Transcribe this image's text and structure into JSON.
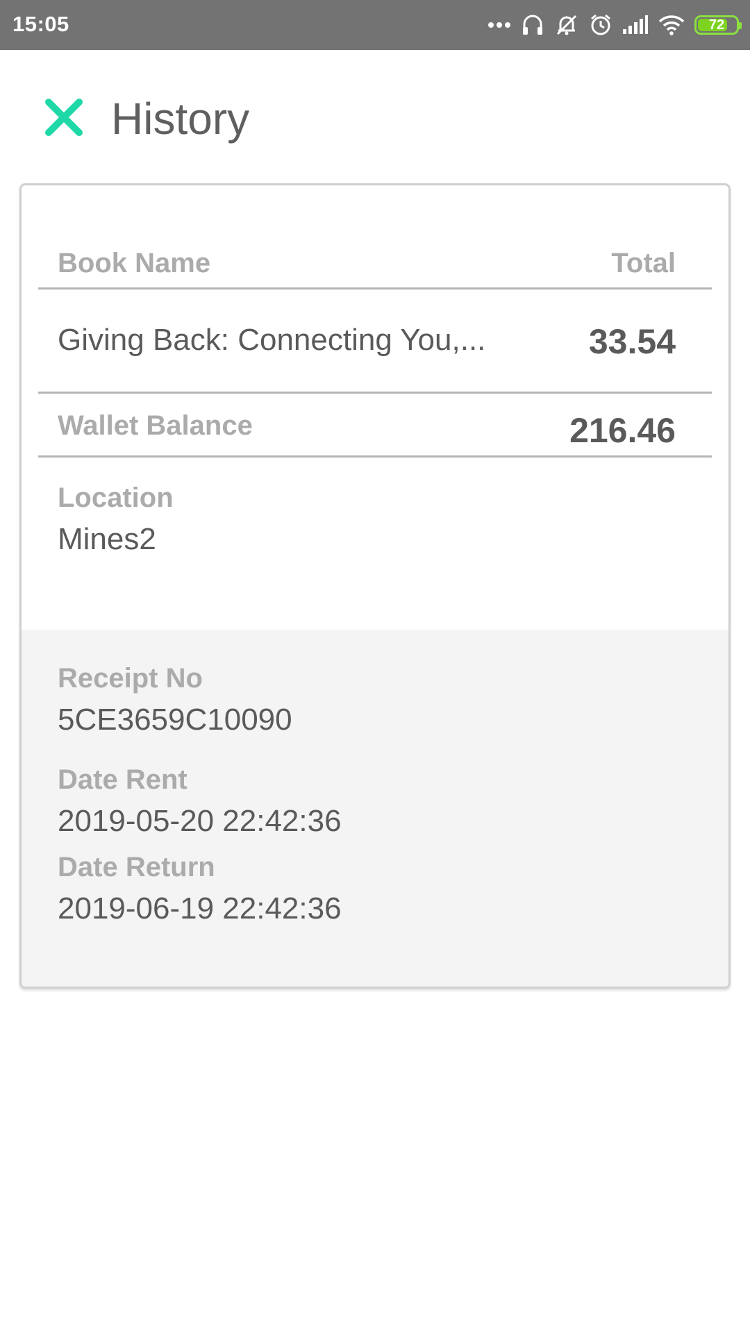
{
  "status_bar": {
    "time": "15:05",
    "battery": "72",
    "icons": [
      "more-dots-icon",
      "headset-icon",
      "bell-off-icon",
      "alarm-icon",
      "signal-icon",
      "wifi-icon",
      "battery-icon"
    ]
  },
  "header": {
    "title": "History",
    "close_icon": "close-icon",
    "accent_color": "#1fd8a8"
  },
  "table": {
    "col_book": "Book Name",
    "col_total": "Total",
    "item": {
      "book_name": "Giving Back: Connecting You,...",
      "total": "33.54"
    }
  },
  "wallet": {
    "label": "Wallet Balance",
    "value": "216.46"
  },
  "location": {
    "label": "Location",
    "value": "Mines2"
  },
  "details": {
    "receipt_label": "Receipt No",
    "receipt_value": "5CE3659C10090",
    "rent_label": "Date Rent",
    "rent_value": "2019-05-20 22:42:36",
    "return_label": "Date Return",
    "return_value": "2019-06-19 22:42:36"
  }
}
